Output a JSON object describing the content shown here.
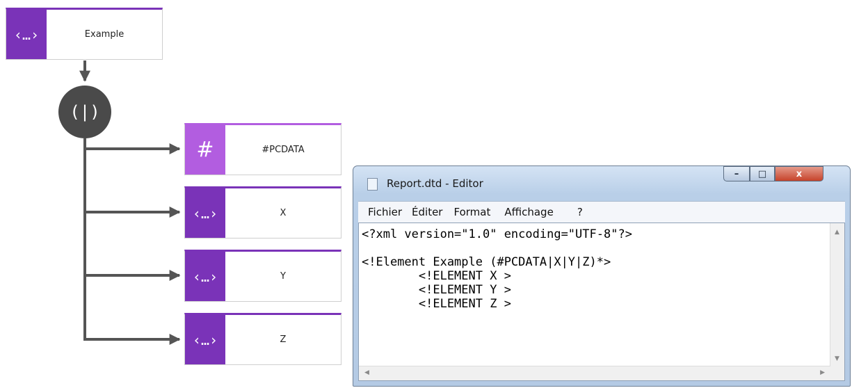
{
  "diagram": {
    "root": {
      "label": "Example",
      "icon": "‹…›"
    },
    "choice": {
      "symbol": "(|)"
    },
    "children": [
      {
        "label": "#PCDATA",
        "icon": "#"
      },
      {
        "label": "X",
        "icon": "‹…›"
      },
      {
        "label": "Y",
        "icon": "‹…›"
      },
      {
        "label": "Z",
        "icon": "‹…›"
      }
    ]
  },
  "editor": {
    "title": "Report.dtd - Editor",
    "buttons": {
      "minimize": "–",
      "maximize": "□",
      "close": "x"
    },
    "menu": [
      "Fichier",
      "Éditer",
      "Format",
      "Affichage",
      "?"
    ],
    "content": "<?xml version=\"1.0\" encoding=\"UTF-8\"?>\n\n<!Element Example (#PCDATA|X|Y|Z)*>\n        <!ELEMENT X >\n        <!ELEMENT Y >\n        <!ELEMENT Z >"
  },
  "colors": {
    "element_purple": "#7a33b8",
    "pcdata_purple": "#b25de0",
    "connector_gray": "#555555",
    "choice_gray": "#4a4a4a"
  }
}
